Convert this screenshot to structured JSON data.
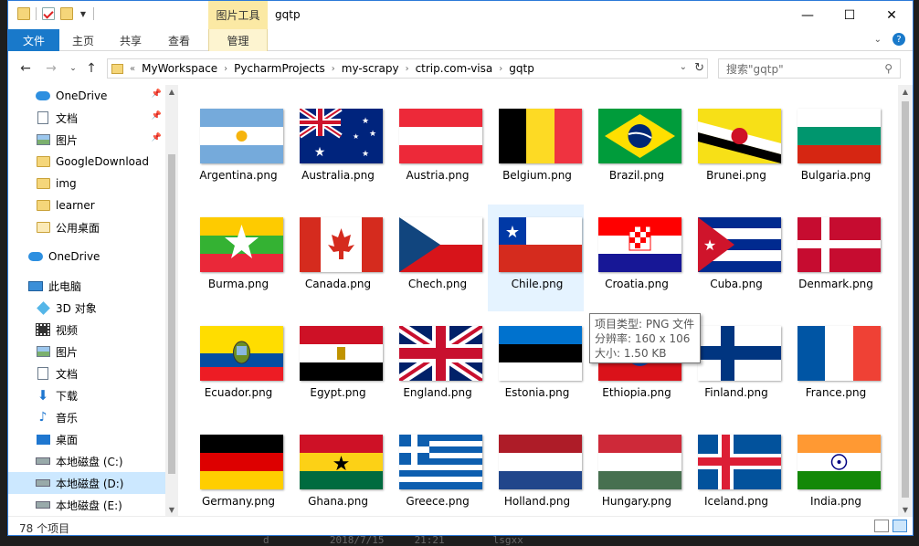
{
  "window": {
    "title": "gqtp",
    "context_header": "图片工具",
    "controls": {
      "minimize": "—",
      "maximize": "☐",
      "close": "✕"
    }
  },
  "ribbon": {
    "tabs": [
      "文件",
      "主页",
      "共享",
      "查看",
      "管理"
    ]
  },
  "address": {
    "prefix": "«",
    "breadcrumb": [
      "MyWorkspace",
      "PycharmProjects",
      "my-scrapy",
      "ctrip.com-visa",
      "gqtp"
    ],
    "search_placeholder": "搜索\"gqtp\""
  },
  "sidebar": {
    "items": [
      {
        "label": "OneDrive",
        "icon": "cloud-icon",
        "pinned": true
      },
      {
        "label": "文档",
        "icon": "document-icon",
        "pinned": true
      },
      {
        "label": "图片",
        "icon": "pictures-icon",
        "pinned": true
      },
      {
        "label": "GoogleDownload",
        "icon": "folder-icon",
        "pinned": false
      },
      {
        "label": "img",
        "icon": "folder-icon",
        "pinned": false
      },
      {
        "label": "learner",
        "icon": "folder-icon",
        "pinned": false
      },
      {
        "label": "公用桌面",
        "icon": "folder-icon",
        "pinned": false
      },
      {
        "label": "OneDrive",
        "icon": "cloud-icon",
        "pinned": false
      },
      {
        "label": "此电脑",
        "icon": "computer-icon",
        "pinned": false
      },
      {
        "label": "3D 对象",
        "icon": "3d-objects-icon",
        "pinned": false
      },
      {
        "label": "视频",
        "icon": "video-icon",
        "pinned": false
      },
      {
        "label": "图片",
        "icon": "pictures-icon",
        "pinned": false
      },
      {
        "label": "文档",
        "icon": "document-icon",
        "pinned": false
      },
      {
        "label": "下载",
        "icon": "download-icon",
        "pinned": false
      },
      {
        "label": "音乐",
        "icon": "music-icon",
        "pinned": false
      },
      {
        "label": "桌面",
        "icon": "desktop-icon",
        "pinned": false
      },
      {
        "label": "本地磁盘 (C:)",
        "icon": "drive-icon",
        "pinned": false
      },
      {
        "label": "本地磁盘 (D:)",
        "icon": "drive-icon",
        "pinned": false,
        "selected": true
      },
      {
        "label": "本地磁盘 (E:)",
        "icon": "drive-icon",
        "pinned": false
      }
    ]
  },
  "files": [
    {
      "name": "Argentina.png"
    },
    {
      "name": "Australia.png"
    },
    {
      "name": "Austria.png"
    },
    {
      "name": "Belgium.png"
    },
    {
      "name": "Brazil.png"
    },
    {
      "name": "Brunei.png"
    },
    {
      "name": "Bulgaria.png"
    },
    {
      "name": "Burma.png"
    },
    {
      "name": "Canada.png"
    },
    {
      "name": "Chech.png"
    },
    {
      "name": "Chile.png"
    },
    {
      "name": "Croatia.png"
    },
    {
      "name": "Cuba.png"
    },
    {
      "name": "Denmark.png"
    },
    {
      "name": "Ecuador.png"
    },
    {
      "name": "Egypt.png"
    },
    {
      "name": "England.png"
    },
    {
      "name": "Estonia.png"
    },
    {
      "name": "Ethiopia.png"
    },
    {
      "name": "Finland.png"
    },
    {
      "name": "France.png"
    },
    {
      "name": "Germany.png"
    },
    {
      "name": "Ghana.png"
    },
    {
      "name": "Greece.png"
    },
    {
      "name": "Holland.png"
    },
    {
      "name": "Hungary.png"
    },
    {
      "name": "Iceland.png"
    },
    {
      "name": "India.png"
    }
  ],
  "tooltip": {
    "line1": "项目类型: PNG 文件",
    "line2": "分辨率: 160 x 106",
    "line3": "大小: 1.50 KB"
  },
  "status": {
    "count": "78 个项目"
  },
  "background_text": "d          2018/7/15     21:21        lsgxx"
}
